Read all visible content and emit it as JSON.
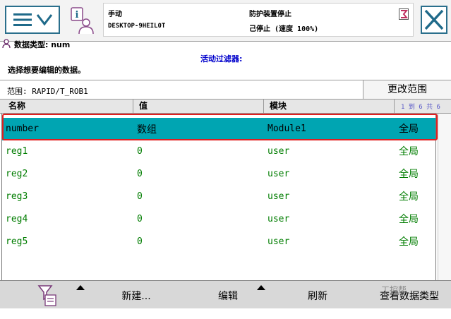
{
  "status": {
    "mode": "手动",
    "host": "DESKTOP-9HEIL0T",
    "safety": "防护装置停止",
    "motor": "己停止 (速度 100%)"
  },
  "toolbar_icons": {
    "menu": "menu-icon",
    "info": "info-user-icon",
    "close": "close-icon",
    "status": "flag-icon"
  },
  "data_type_label": "数据类型: num",
  "active_filter_label": "活动过滤器:",
  "select_prompt": "选择想要编辑的数据。",
  "scope_text": "范围: RAPID/T_ROB1",
  "change_scope_label": "更改范围",
  "table": {
    "headers": [
      "名称",
      "值",
      "模块"
    ],
    "pager": "1 到 6 共 6",
    "rows": [
      {
        "name": "number",
        "value": "数组",
        "module": "Module1",
        "scope": "全局"
      },
      {
        "name": "reg1",
        "value": "0",
        "module": "user",
        "scope": "全局"
      },
      {
        "name": "reg2",
        "value": "0",
        "module": "user",
        "scope": "全局"
      },
      {
        "name": "reg3",
        "value": "0",
        "module": "user",
        "scope": "全局"
      },
      {
        "name": "reg4",
        "value": "0",
        "module": "user",
        "scope": "全局"
      },
      {
        "name": "reg5",
        "value": "0",
        "module": "user",
        "scope": "全局"
      }
    ]
  },
  "bottom": {
    "new_label": "新建...",
    "edit_label": "编辑",
    "refresh_label": "刷新",
    "view_type_label": "查看数据类型"
  },
  "watermark": "工控帮",
  "colors": {
    "accent": "#2a6f8c",
    "selected_row": "#00a5b2",
    "row_text": "#007d00",
    "highlight": "#e02020"
  }
}
